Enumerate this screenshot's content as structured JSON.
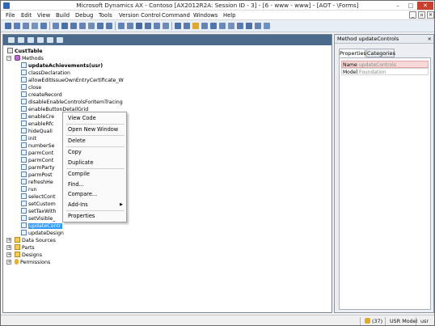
{
  "window": {
    "title": "Microsoft Dynamics AX - Contoso [AX2012R2A: Session ID - 3] - [6 - www - www] - [AOT - \\Forms]",
    "controls": [
      "–",
      "□",
      "✕"
    ]
  },
  "menubar": {
    "items": [
      "File",
      "Edit",
      "View",
      "Build",
      "Debug",
      "Tools",
      "Version Control",
      "Command",
      "Windows",
      "Help"
    ],
    "mdi_controls": [
      "_",
      "▫",
      "×"
    ]
  },
  "tree": {
    "root": "CustTable",
    "methods_folder": "Methods",
    "methods": [
      "updateAchievements(usr)",
      "classDeclaration",
      "allowEditIssueOwnEntryCertificate_W",
      "close",
      "createRecord",
      "disableEnableControlsForItemTracing",
      "enableButtonDetailGrid",
      "enableCre",
      "enableRfc",
      "hideQuali",
      "init",
      "numberSe",
      "parmCont",
      "parmCont",
      "parmParty",
      "parmPost",
      "refreshHe",
      "run",
      "selectCont",
      "setCustom",
      "setTaxWith",
      "setVisible_",
      "updateContr",
      "updateDesign"
    ],
    "other_nodes": [
      "Data Sources",
      "Parts",
      "Designs",
      "Permissions"
    ]
  },
  "context_menu": {
    "items": [
      "View Code",
      "Open New Window",
      "Delete",
      "Copy",
      "Duplicate",
      "Compile",
      "Find...",
      "Compare...",
      "Add-Ins",
      "Properties"
    ]
  },
  "properties": {
    "header": "Method updateControls",
    "close": "×",
    "tabs": [
      "Properties",
      "Categories"
    ],
    "rows": [
      {
        "key": "Name",
        "value": "updateControls"
      },
      {
        "key": "Model",
        "value": "Foundation"
      }
    ]
  },
  "statusbar": {
    "notifications": "(37)",
    "model": "USR Model",
    "user": "usr"
  },
  "colors": {
    "selection": "#3399ff",
    "toolbar_dark": "#4c6a8c",
    "close_button": "#c7402f"
  }
}
